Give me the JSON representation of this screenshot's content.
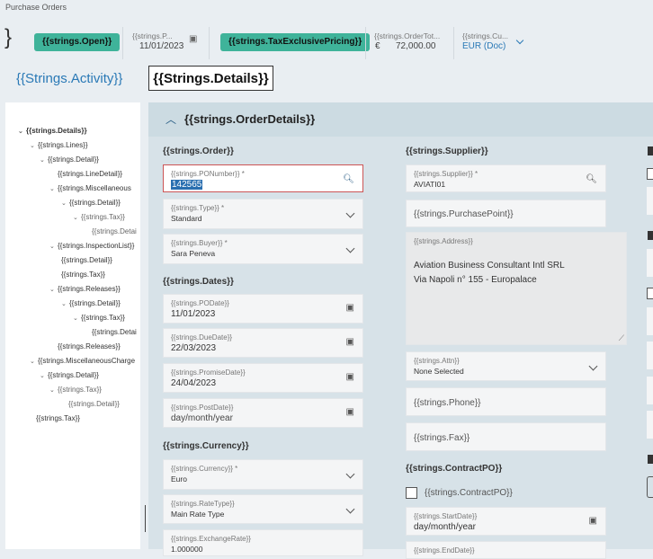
{
  "breadcrumb": "Purchase Orders",
  "header": {
    "brace": "}",
    "status_pill": "{{strings.Open}}",
    "po_date_label": "{{strings.P...",
    "po_date_value": "11/01/2023",
    "pricing_pill": "{{strings.TaxExclusivePricing}}",
    "order_total_label": "{{strings.OrderTot...",
    "currency_symbol": "€",
    "order_total_value": "72,000.00",
    "currency_label": "{{strings.Cu...",
    "currency_value": "EUR (Doc)"
  },
  "tabs": {
    "activity": "{{Strings.Activity}}",
    "details": "{{Strings.Details}}"
  },
  "tree": [
    {
      "label": "{{strings.Details}}",
      "caret": "v",
      "bold": true
    },
    {
      "label": "{{strings.Lines}}",
      "caret": "v"
    },
    {
      "label": "{{strings.Detail}}",
      "caret": "v"
    },
    {
      "label": "{{strings.LineDetail}}",
      "caret": ""
    },
    {
      "label": "{{strings.Miscellaneous",
      "caret": "v"
    },
    {
      "label": "{{strings.Detail}}",
      "caret": "v"
    },
    {
      "label": "{{strings.Tax}}",
      "caret": "v",
      "muted": true
    },
    {
      "label": "{{strings.Detai",
      "caret": "",
      "muted": true
    },
    {
      "label": "{{strings.InspectionList}}",
      "caret": "v"
    },
    {
      "label": "{{strings.Detail}}",
      "caret": ""
    },
    {
      "label": "{{strings.Tax}}",
      "caret": ""
    },
    {
      "label": "{{strings.Releases}}",
      "caret": "v"
    },
    {
      "label": "{{strings.Detail}}",
      "caret": "v"
    },
    {
      "label": "{{strings.Tax}}",
      "caret": "v"
    },
    {
      "label": "{{strings.Detai",
      "caret": ""
    },
    {
      "label": "{{strings.Releases}}",
      "caret": ""
    },
    {
      "label": "{{strings.MiscellaneousCharge",
      "caret": "v"
    },
    {
      "label": "{{strings.Detail}}",
      "caret": "v"
    },
    {
      "label": "{{strings.Tax}}",
      "caret": "v",
      "muted": true
    },
    {
      "label": "{{strings.Detail}}",
      "caret": "",
      "muted": true
    },
    {
      "label": "{{strings.Tax}}",
      "caret": ""
    }
  ],
  "section": {
    "title": "{{strings.OrderDetails}}"
  },
  "order": {
    "title": "{{strings.Order}}",
    "po_number_label": "{{strings.PONumber}} *",
    "po_number_value": "142565",
    "type_label": "{{strings.Type}} *",
    "type_value": "Standard",
    "buyer_label": "{{strings.Buyer}} *",
    "buyer_value": "Sara Peneva"
  },
  "dates": {
    "title": "{{strings.Dates}}",
    "po_date_label": "{{strings.PODate}}",
    "po_date_value": "11/01/2023",
    "due_date_label": "{{strings.DueDate}}",
    "due_date_value": "22/03/2023",
    "promise_date_label": "{{strings.PromiseDate}}",
    "promise_date_value": "24/04/2023",
    "post_date_label": "{{strings.PostDate}}",
    "post_date_value": "day/month/year"
  },
  "currency": {
    "title": "{{strings.Currency}}",
    "currency_label": "{{strings.Currency}} *",
    "currency_value": "Euro",
    "rate_type_label": "{{strings.RateType}}",
    "rate_type_value": "Main Rate Type",
    "exchange_rate_label": "{{strings.ExchangeRate}}",
    "exchange_rate_value": "1.000000"
  },
  "supplier": {
    "title": "{{strings.Supplier}}",
    "supplier_label": "{{strings.Supplier}} *",
    "supplier_value": "AVIATI01",
    "purchase_point_placeholder": "{{strings.PurchasePoint}}",
    "address_label": "{{strings.Address}}",
    "address_line1": "Aviation Business Consultant Intl SRL",
    "address_line2": "Via Napoli n° 155 - Europalace",
    "attn_label": "{{strings.Attn}}",
    "attn_value": "None Selected",
    "phone_placeholder": "{{strings.Phone}}",
    "fax_placeholder": "{{strings.Fax}}"
  },
  "contract": {
    "title": "{{strings.ContractPO}}",
    "checkbox_label": "{{strings.ContractPO}}",
    "start_date_label": "{{strings.StartDate}}",
    "start_date_value": "day/month/year",
    "end_date_label": "{{strings.EndDate}}"
  },
  "colors": {
    "accent_pill": "#3fb39a",
    "link_blue": "#2a79b6",
    "panel": "#d7e2e8"
  }
}
